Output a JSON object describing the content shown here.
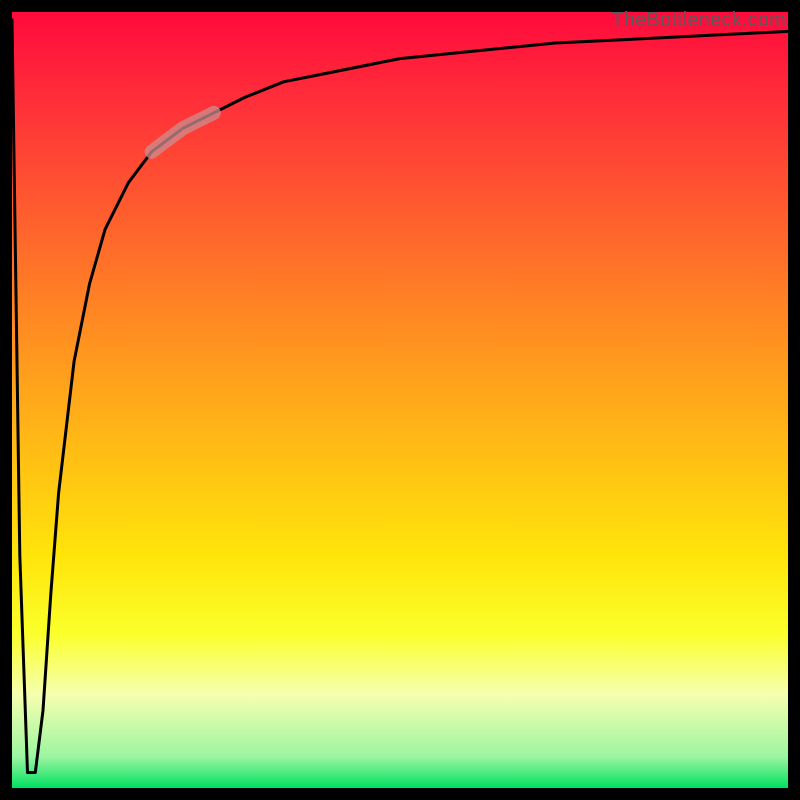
{
  "attribution": "TheBottleneck.com",
  "chart_data": {
    "type": "line",
    "title": "",
    "xlabel": "",
    "ylabel": "",
    "xlim": [
      0,
      100
    ],
    "ylim": [
      0,
      100
    ],
    "series": [
      {
        "name": "bottleneck-curve",
        "x": [
          0,
          1,
          2,
          3,
          4,
          5,
          6,
          8,
          10,
          12,
          15,
          18,
          22,
          26,
          30,
          35,
          40,
          50,
          60,
          70,
          80,
          90,
          100
        ],
        "values": [
          99,
          30,
          2,
          2,
          10,
          25,
          38,
          55,
          65,
          72,
          78,
          82,
          85,
          87,
          89,
          91,
          92,
          94,
          95,
          96,
          96.5,
          97,
          97.5
        ]
      }
    ],
    "colors": {
      "curve": "#000000",
      "highlight": "#cc8d8f",
      "gradient_top": "#ff0a3c",
      "gradient_bottom": "#00e060"
    },
    "highlighted_segment_x_range": [
      18,
      28
    ]
  }
}
